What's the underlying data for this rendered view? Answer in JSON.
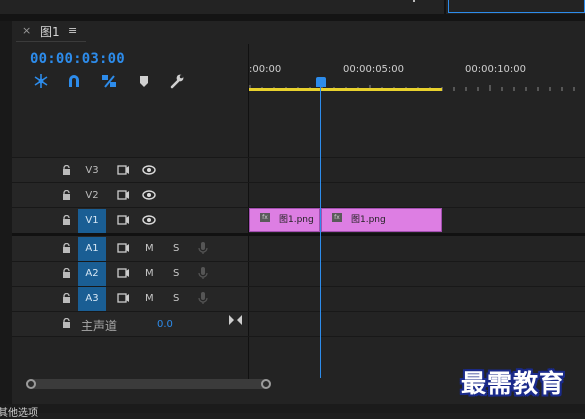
{
  "sequence": {
    "tab_close": "×",
    "tab_title": "图1",
    "tab_menu": "≡",
    "timecode": "00:00:03:00"
  },
  "toolbar": {
    "icons": [
      "snap-insert-icon",
      "magnet-icon",
      "linked-selection-icon",
      "marker-icon",
      "wrench-icon"
    ]
  },
  "ruler": {
    "labels": [
      ":00:00",
      "00:00:05:00",
      "00:00:10:00"
    ]
  },
  "video_tracks": [
    {
      "name": "V3",
      "active": false
    },
    {
      "name": "V2",
      "active": false
    },
    {
      "name": "V1",
      "active": true
    }
  ],
  "audio_tracks": [
    {
      "name": "A1",
      "m": "M",
      "s": "S"
    },
    {
      "name": "A2",
      "m": "M",
      "s": "S"
    },
    {
      "name": "A3",
      "m": "M",
      "s": "S"
    }
  ],
  "master": {
    "name": "主声道",
    "value": "0.0"
  },
  "clips": [
    {
      "label": "图1.png",
      "fx": "fx"
    },
    {
      "label": "图1.png",
      "fx": "fx"
    }
  ],
  "footer": {
    "text": "其他选项"
  },
  "watermark": {
    "text": "最需教育"
  },
  "colors": {
    "accent": "#2d8ceb",
    "clip": "#dd7ee3",
    "in_out_bar": "#e8d12d",
    "track_active": "#1a5e94"
  }
}
